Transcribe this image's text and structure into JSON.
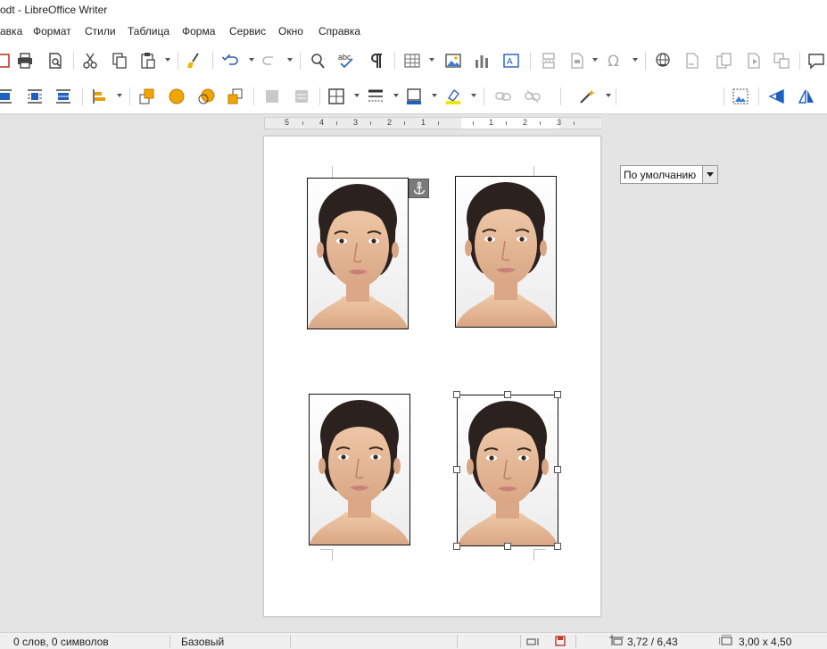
{
  "window": {
    "title": "odt - LibreOffice Writer"
  },
  "menu": [
    "авка",
    "Формат",
    "Стили",
    "Таблица",
    "Форма",
    "Сервис",
    "Окно",
    "Справка"
  ],
  "toolbar": {
    "paragraph_style": "По умолчанию"
  },
  "ruler": {
    "labels": [
      "5",
      "4",
      "3",
      "2",
      "1",
      "1",
      "2",
      "3"
    ]
  },
  "status": {
    "words": "0 слов, 0 символов",
    "page_style": "Базовый",
    "position": "3,72 / 6,43",
    "size": "3,00 x 4,50"
  },
  "colors": {
    "accent_yellow": "#f5e400",
    "accent_blue": "#1f5fbf",
    "selection_handle": "#555555"
  },
  "icons": [
    "print-icon",
    "print-preview-icon",
    "cut-icon",
    "copy-icon",
    "paste-icon",
    "clone-formatting-icon",
    "undo-icon",
    "redo-icon",
    "find-replace-icon",
    "spelling-icon",
    "formatting-marks-icon",
    "table-icon",
    "image-icon",
    "chart-icon",
    "textbox-icon",
    "page-break-icon",
    "field-icon",
    "special-character-icon",
    "hyperlink-icon",
    "footnote-icon",
    "endnote-icon",
    "bookmark-icon",
    "cross-reference-icon",
    "comment-icon",
    "anchor-icon"
  ]
}
